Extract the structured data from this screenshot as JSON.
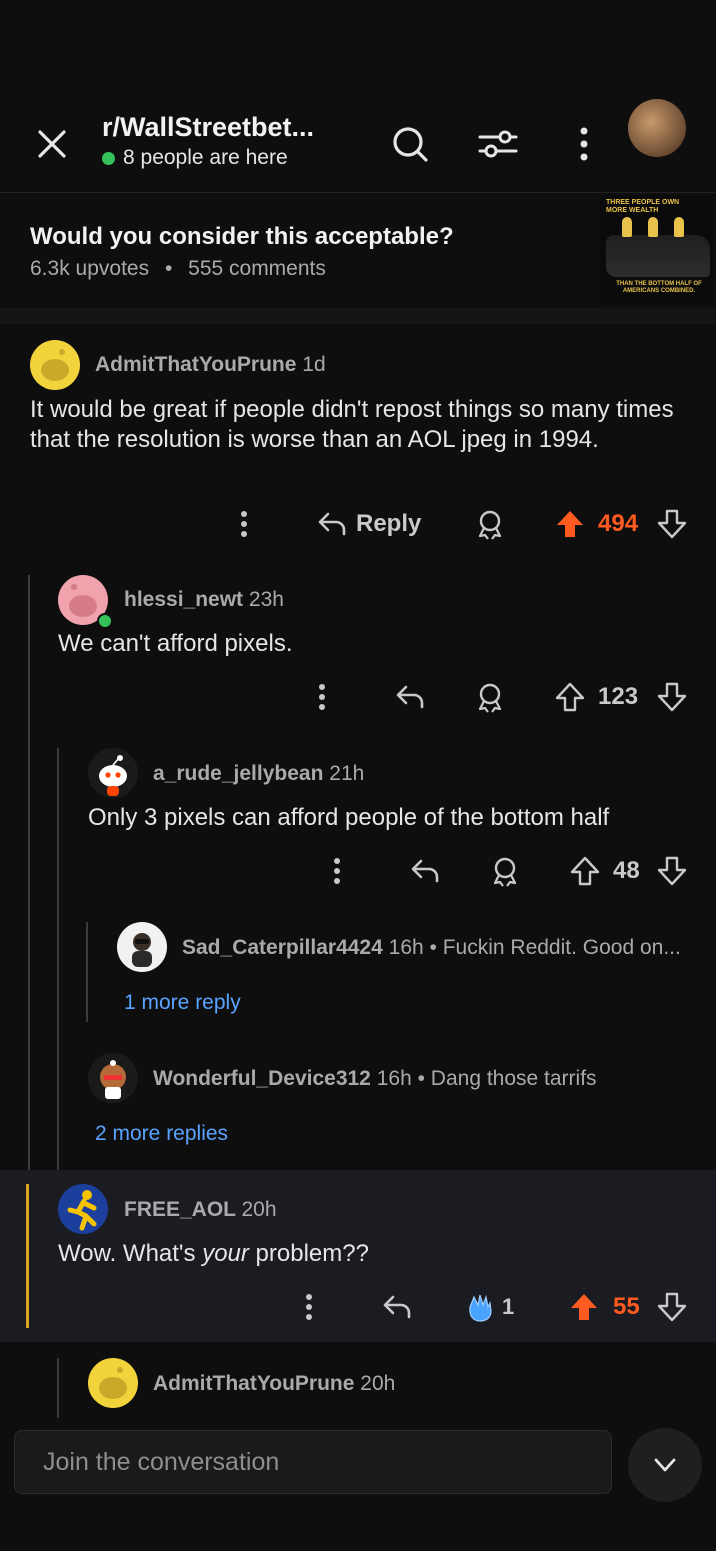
{
  "header": {
    "subreddit": "r/WallStreetbet...",
    "presence": "8 people are here"
  },
  "post": {
    "title": "Would you consider this acceptable?",
    "upvotes": "6.3k upvotes",
    "separator": "•",
    "comments": "555 comments",
    "thumb_top": "THREE PEOPLE OWN MORE WEALTH",
    "thumb_bottom": "THAN THE BOTTOM HALF OF AMERICANS COMBINED."
  },
  "comments": [
    {
      "user": "AdmitThatYouPrune",
      "age": "1d",
      "text": "It would be great if people didn't repost things so many times that the resolution is worse than an AOL jpeg in 1994.",
      "reply_label": "Reply",
      "votes": "494"
    },
    {
      "user": "hlessi_newt",
      "age": "23h",
      "text": "We can't afford pixels.",
      "votes": "123"
    },
    {
      "user": "a_rude_jellybean",
      "age": "21h",
      "text": "Only 3 pixels can afford people of the bottom half",
      "votes": "48"
    },
    {
      "user": "Sad_Caterpillar4424",
      "age": "16h",
      "snippet": "• Fuckin Reddit. Good on...",
      "more": "1 more reply"
    },
    {
      "user": "Wonderful_Device312",
      "age": "16h",
      "snippet": "• Dang those tarrifs",
      "more": "2 more replies"
    },
    {
      "user": "FREE_AOL",
      "age": "20h",
      "text_pre": "Wow. What's ",
      "text_em": "your",
      "text_post": " problem??",
      "award_count": "1",
      "votes": "55"
    },
    {
      "user": "AdmitThatYouPrune",
      "age": "20h"
    }
  ],
  "composer": {
    "placeholder": "Join the conversation"
  },
  "colors": {
    "upvote": "#ff5a1f",
    "link": "#5aa3ff",
    "online": "#35c05a",
    "highlight_bar": "#d9a71c"
  }
}
